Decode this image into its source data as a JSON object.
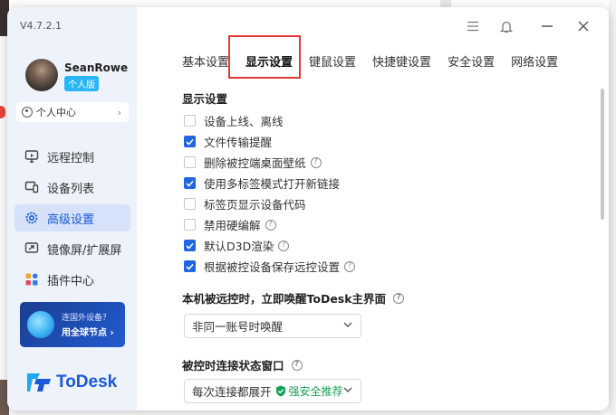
{
  "app": {
    "version": "V4.7.2.1",
    "logo_text": "ToDesk"
  },
  "user": {
    "name": "SeanRowe",
    "badge": "个人版",
    "personal_center": "个人中心"
  },
  "nav": [
    {
      "label": "远程控制",
      "icon": "remote-control-icon",
      "active": false
    },
    {
      "label": "设备列表",
      "icon": "device-list-icon",
      "active": false
    },
    {
      "label": "高级设置",
      "icon": "settings-icon",
      "active": true
    },
    {
      "label": "镜像屏/扩展屏",
      "icon": "mirror-screen-icon",
      "active": false
    },
    {
      "label": "插件中心",
      "icon": "plugin-icon",
      "active": false
    }
  ],
  "promo": {
    "line1": "连国外设备？",
    "line2": "用全球节点 ›"
  },
  "tabs": [
    {
      "label": "基本设置",
      "active": false
    },
    {
      "label": "显示设置",
      "active": true
    },
    {
      "label": "键鼠设置",
      "active": false
    },
    {
      "label": "快捷键设置",
      "active": false
    },
    {
      "label": "安全设置",
      "active": false
    },
    {
      "label": "网络设置",
      "active": false
    }
  ],
  "display_settings": {
    "title": "显示设置",
    "options": [
      {
        "label": "设备上线、离线",
        "checked": false,
        "help": false
      },
      {
        "label": "文件传输提醒",
        "checked": true,
        "help": false
      },
      {
        "label": "删除被控端桌面壁纸",
        "checked": false,
        "help": true
      },
      {
        "label": "使用多标签模式打开新链接",
        "checked": true,
        "help": false
      },
      {
        "label": "标签页显示设备代码",
        "checked": false,
        "help": false
      },
      {
        "label": "禁用硬编解",
        "checked": false,
        "help": true
      },
      {
        "label": "默认D3D渲染",
        "checked": true,
        "help": true
      },
      {
        "label": "根据被控设备保存远控设置",
        "checked": true,
        "help": true
      }
    ]
  },
  "wake_section": {
    "title": "本机被远控时，立即唤醒ToDesk主界面",
    "value": "非同一账号时唤醒"
  },
  "status_window_section": {
    "title": "被控时连接状态窗口",
    "value": "每次连接都展开",
    "recommend": "强安全推荐"
  },
  "colors": {
    "accent": "#2165e0",
    "sidebar_bg": "#edf2fb",
    "highlight_border": "#e53935",
    "recommend_green": "#18a058"
  }
}
